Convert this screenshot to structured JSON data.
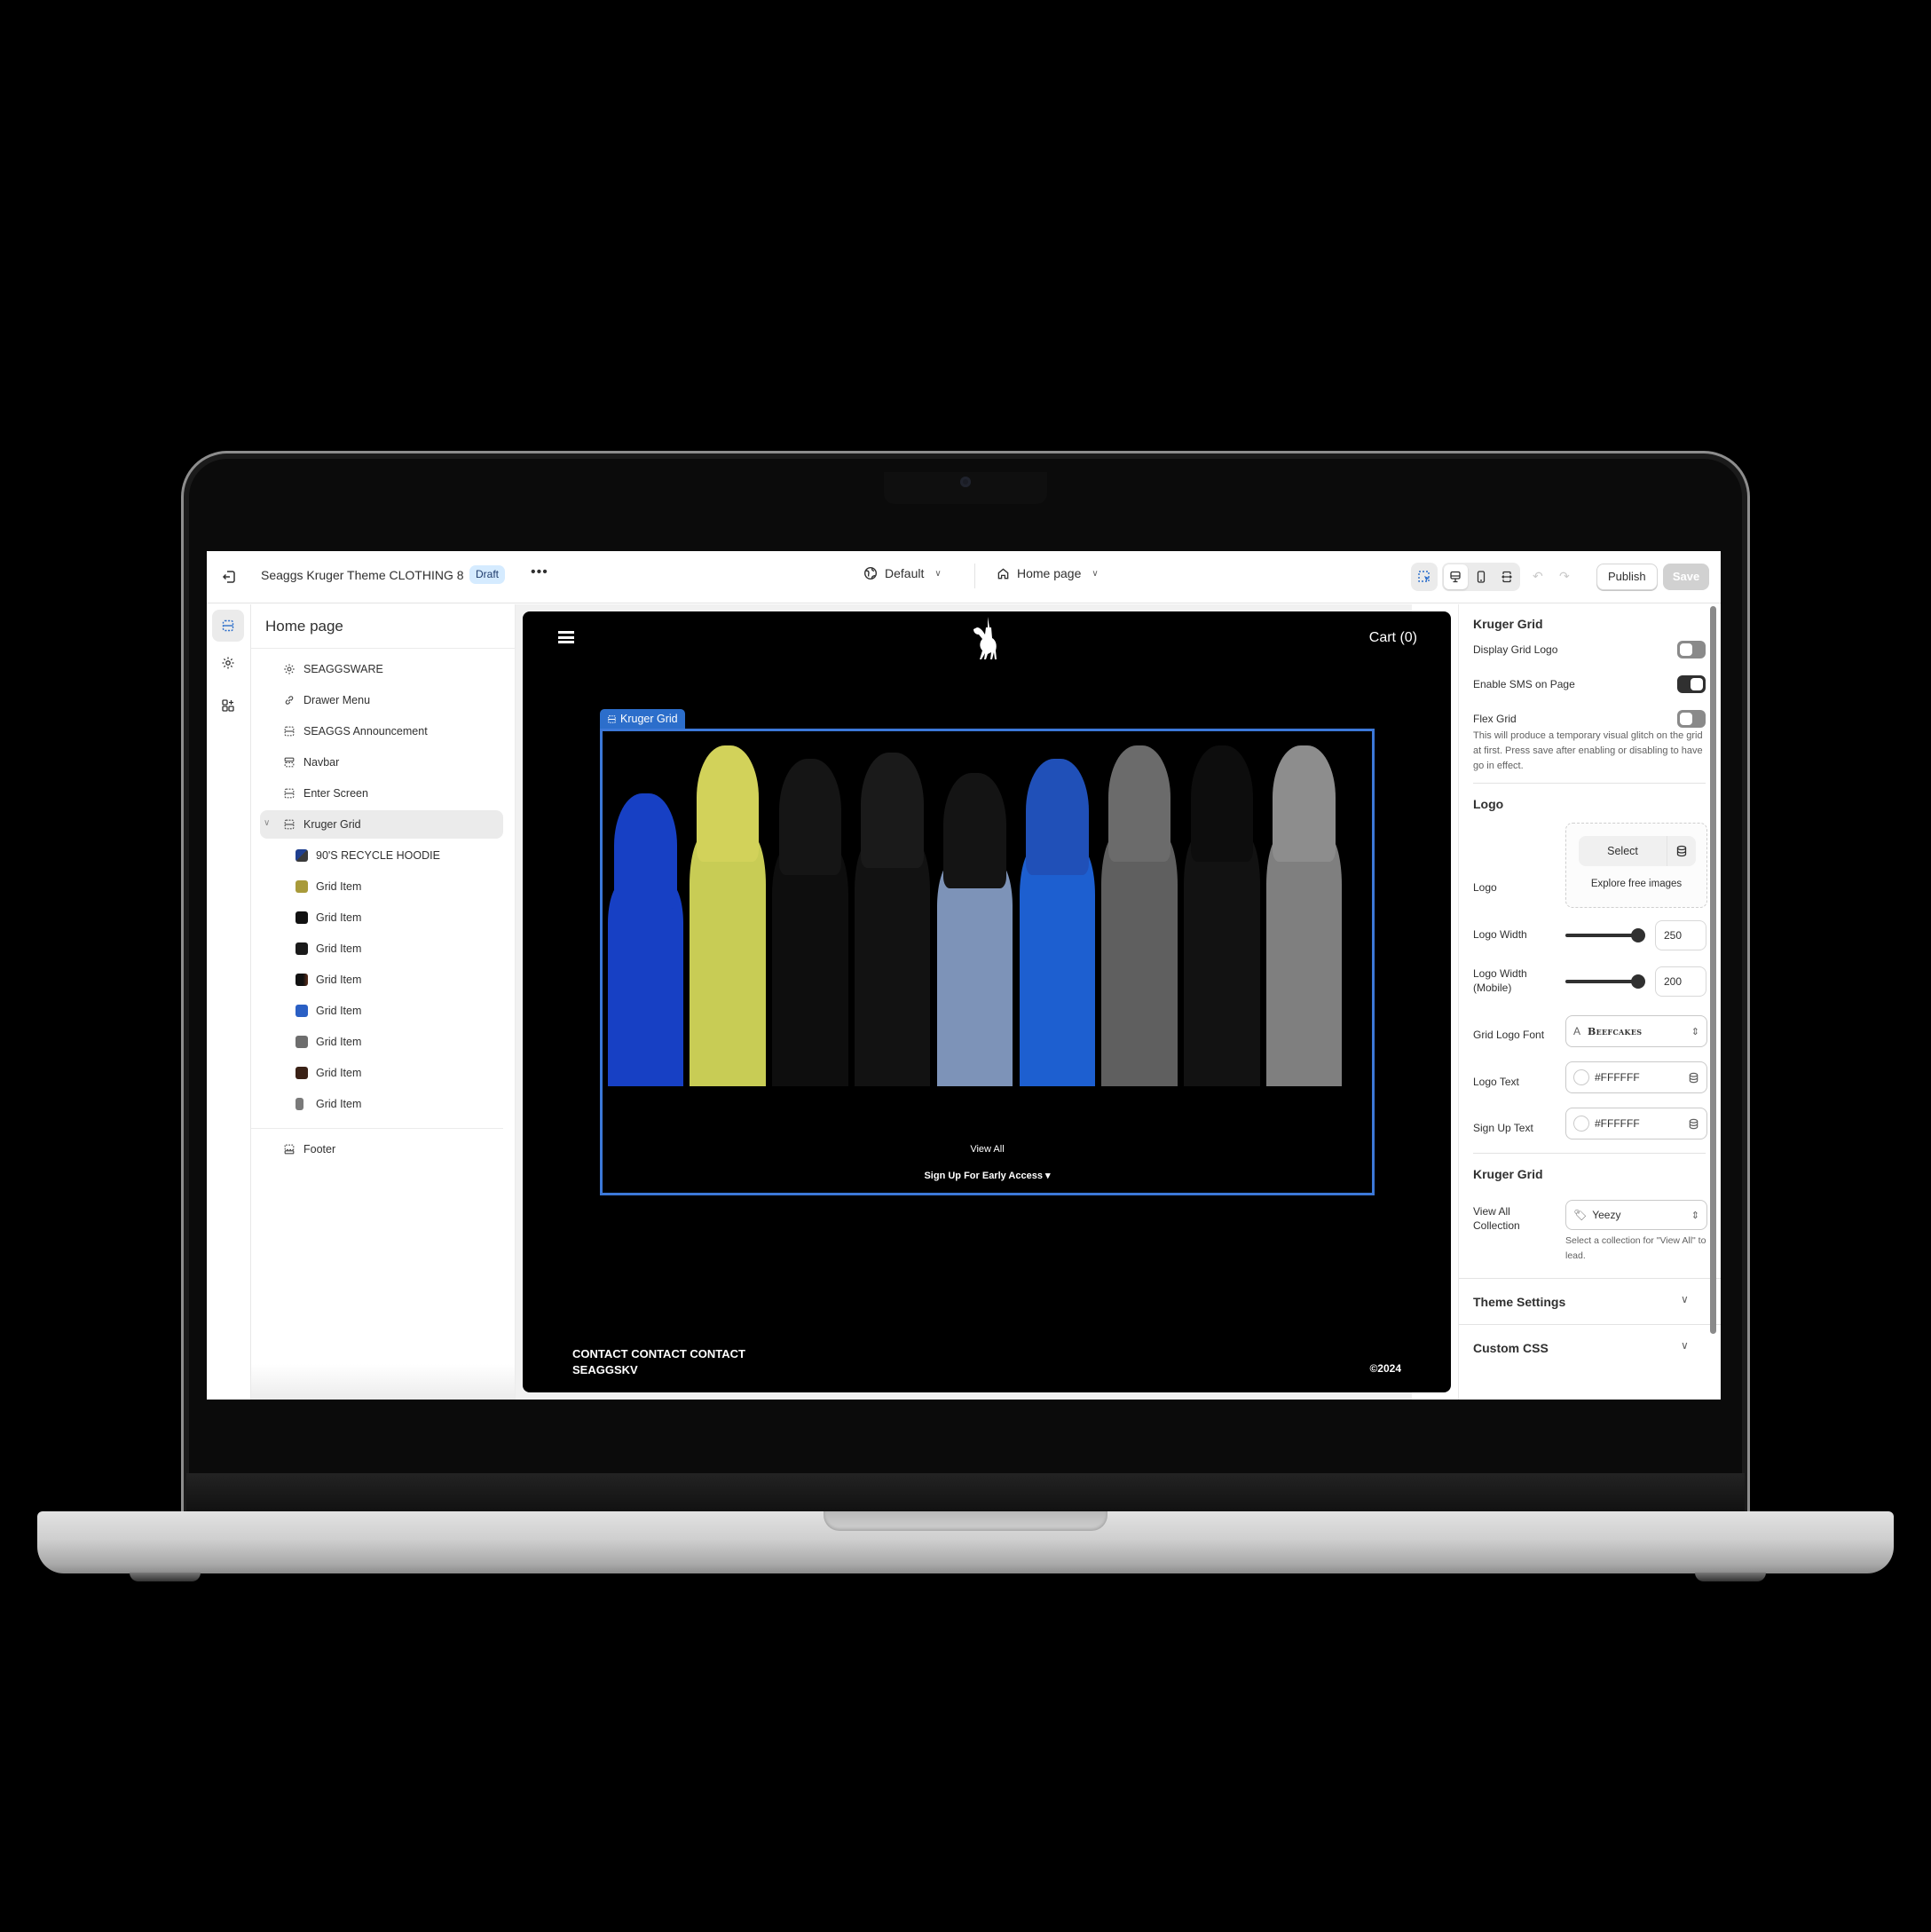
{
  "topbar": {
    "exit_icon": "exit-icon",
    "theme_name": "Seaggs Kruger Theme CLOTHING 8",
    "status_badge": "Draft",
    "more_label": "•••",
    "theme_selector": {
      "icon": "globe-icon",
      "label": "Default"
    },
    "page_selector": {
      "icon": "home-icon",
      "label": "Home page"
    },
    "tools": {
      "inspector": "select-element-icon",
      "devices": [
        "desktop-icon",
        "mobile-icon",
        "fullwidth-icon"
      ],
      "active_device": "desktop"
    },
    "undo_label": "↶",
    "redo_label": "↷",
    "publish_label": "Publish",
    "save_label": "Save"
  },
  "rail": {
    "items": [
      {
        "icon": "sections-icon",
        "active": true
      },
      {
        "icon": "gear-icon",
        "active": false
      },
      {
        "icon": "apps-icon",
        "active": false
      }
    ]
  },
  "sidebar": {
    "title": "Home page",
    "sections": [
      {
        "label": "SEAGGSWARE",
        "icon": "gear-icon"
      },
      {
        "label": "Drawer Menu",
        "icon": "link-icon"
      },
      {
        "label": "SEAGGS Announcement",
        "icon": "section-icon"
      },
      {
        "label": "Navbar",
        "icon": "header-icon"
      },
      {
        "label": "Enter Screen",
        "icon": "section-icon"
      },
      {
        "label": "Kruger Grid",
        "icon": "section-icon",
        "expanded": true,
        "selected": true
      }
    ],
    "blocks": [
      {
        "label": "90'S RECYCLE HOODIE",
        "thumb_color": "#1f3f8f"
      },
      {
        "label": "Grid Item",
        "thumb_color": "#a89a3a"
      },
      {
        "label": "Grid Item",
        "thumb_color": "#111111"
      },
      {
        "label": "Grid Item",
        "thumb_color": "#1a1a1a"
      },
      {
        "label": "Grid Item",
        "thumb_color": "#2a1a14"
      },
      {
        "label": "Grid Item",
        "thumb_color": "#2a5fc4"
      },
      {
        "label": "Grid Item",
        "thumb_color": "#6d6d6d"
      },
      {
        "label": "Grid Item",
        "thumb_color": "#3a2116"
      },
      {
        "label": "Grid Item",
        "thumb_color": "#7a7a7a"
      }
    ],
    "footer_section": {
      "label": "Footer",
      "icon": "footer-icon"
    }
  },
  "preview": {
    "cart_label": "Cart (0)",
    "section_tag": "Kruger Grid",
    "view_all_label": "View All",
    "signup_label": "Sign Up For Early Access ▾",
    "contact_line1": "CONTACT CONTACT CONTACT",
    "contact_line2": "SEAGGSKV",
    "copyright": "©2024",
    "grid_strips": [
      {
        "hood": "#1740c4",
        "body": "#1740c4"
      },
      {
        "hood": "#d2d25a",
        "body": "#c8cc55"
      },
      {
        "hood": "#151515",
        "body": "#0e0e0e"
      },
      {
        "hood": "#1a1a1a",
        "body": "#121212"
      },
      {
        "hood": "#141414",
        "body": "#7d93b8"
      },
      {
        "hood": "#2050b8",
        "body": "#1d5fd0"
      },
      {
        "hood": "#6b6b6b",
        "body": "#5f5f5f"
      },
      {
        "hood": "#0d0d0d",
        "body": "#121212"
      },
      {
        "hood": "#8d8d8d",
        "body": "#7f7f7f"
      }
    ]
  },
  "settings": {
    "section_title": "Kruger Grid",
    "toggles": [
      {
        "label": "Display Grid Logo",
        "on": false
      },
      {
        "label": "Enable SMS on Page",
        "on": true
      },
      {
        "label": "Flex Grid",
        "on": false
      }
    ],
    "flex_help": "This will produce a temporary visual glitch on the grid at first. Press save after enabling or disabling to have go in effect.",
    "logo_heading": "Logo",
    "logo_label": "Logo",
    "logo_select_label": "Select",
    "logo_explore_label": "Explore free images",
    "logo_width_label": "Logo Width",
    "logo_width_value": "250",
    "logo_width_mobile_label": "Logo Width (Mobile)",
    "logo_width_mobile_value": "200",
    "grid_logo_font_label": "Grid Logo Font",
    "grid_logo_font_value": "Beefcakes",
    "logo_text_label": "Logo Text",
    "logo_text_color": "#FFFFFF",
    "signup_text_label": "Sign Up Text",
    "signup_text_color": "#FFFFFF",
    "grid_heading": "Kruger Grid",
    "view_all_collection_label": "View All Collection",
    "view_all_collection_value": "Yeezy",
    "view_all_help": "Select a collection for \"View All\" to lead.",
    "accordions": [
      {
        "label": "Theme Settings"
      },
      {
        "label": "Custom CSS"
      }
    ]
  },
  "colors": {
    "accent_blue": "#2c6ecb",
    "selection_outline": "#3c78d8",
    "draft_badge_bg": "#d5ebff",
    "toggle_on": "#303030",
    "toggle_off": "#8a8a8a"
  }
}
